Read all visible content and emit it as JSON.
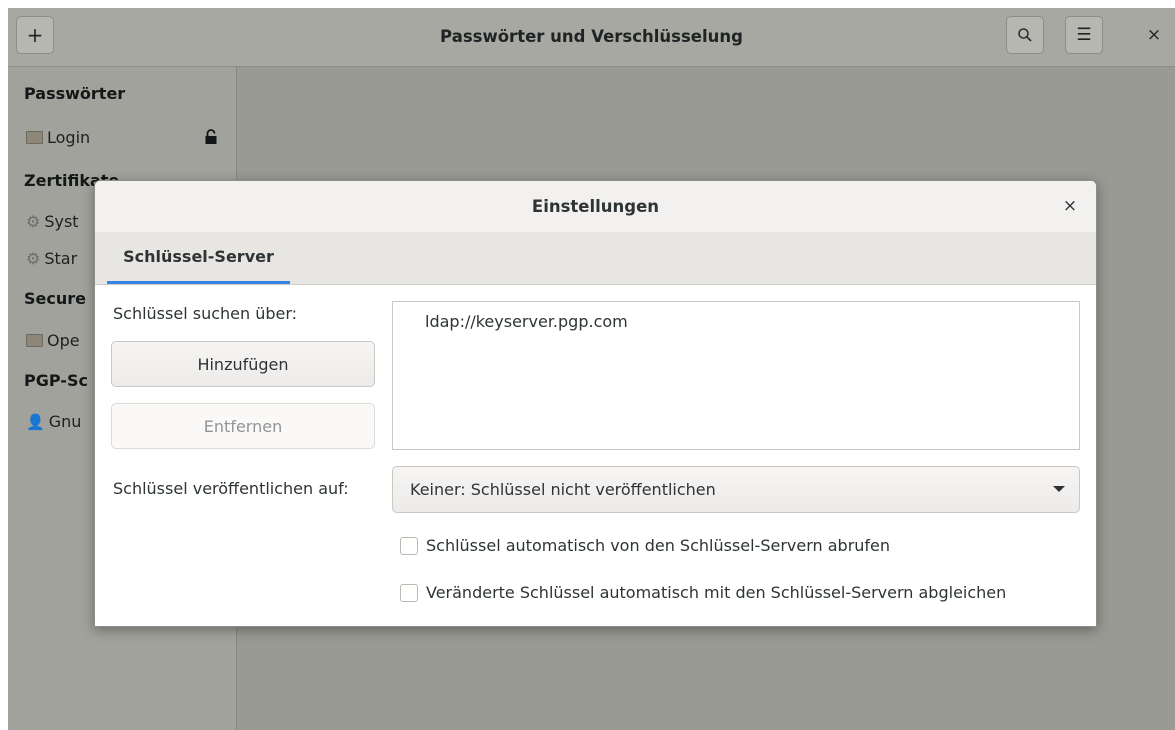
{
  "window": {
    "title": "Passwörter und Verschlüsselung",
    "add_icon": "+",
    "search_icon": "search-icon",
    "menu_icon": "☰",
    "close_icon": "×"
  },
  "sidebar": {
    "sections": [
      {
        "heading": "Passwörter",
        "items": [
          {
            "label": "Login",
            "icon": "folder-icon",
            "locked": true
          }
        ]
      },
      {
        "heading": "Zertifikate",
        "items": [
          {
            "label": "Syst",
            "icon": "gear-icon"
          },
          {
            "label": "Star",
            "icon": "gear-icon"
          }
        ]
      },
      {
        "heading": "Secure",
        "items": [
          {
            "label": "Ope",
            "icon": "folder-icon"
          }
        ]
      },
      {
        "heading": "PGP-Sc",
        "items": [
          {
            "label": "Gnu",
            "icon": "person-icon"
          }
        ]
      }
    ]
  },
  "dialog": {
    "title": "Einstellungen",
    "close_icon": "×",
    "tab": "Schlüssel-Server",
    "search_label": "Schlüssel suchen über:",
    "add_button": "Hinzufügen",
    "remove_button": "Entfernen",
    "servers": [
      "ldap://keyserver.pgp.com"
    ],
    "publish_label": "Schlüssel veröffentlichen auf:",
    "publish_selected": "Keiner: Schlüssel nicht veröffentlichen",
    "auto_retrieve_label": "Schlüssel automatisch von den Schlüssel-Servern abrufen",
    "auto_retrieve_checked": false,
    "auto_sync_label": "Veränderte Schlüssel automatisch mit den Schlüssel-Servern abgleichen",
    "auto_sync_checked": false
  }
}
